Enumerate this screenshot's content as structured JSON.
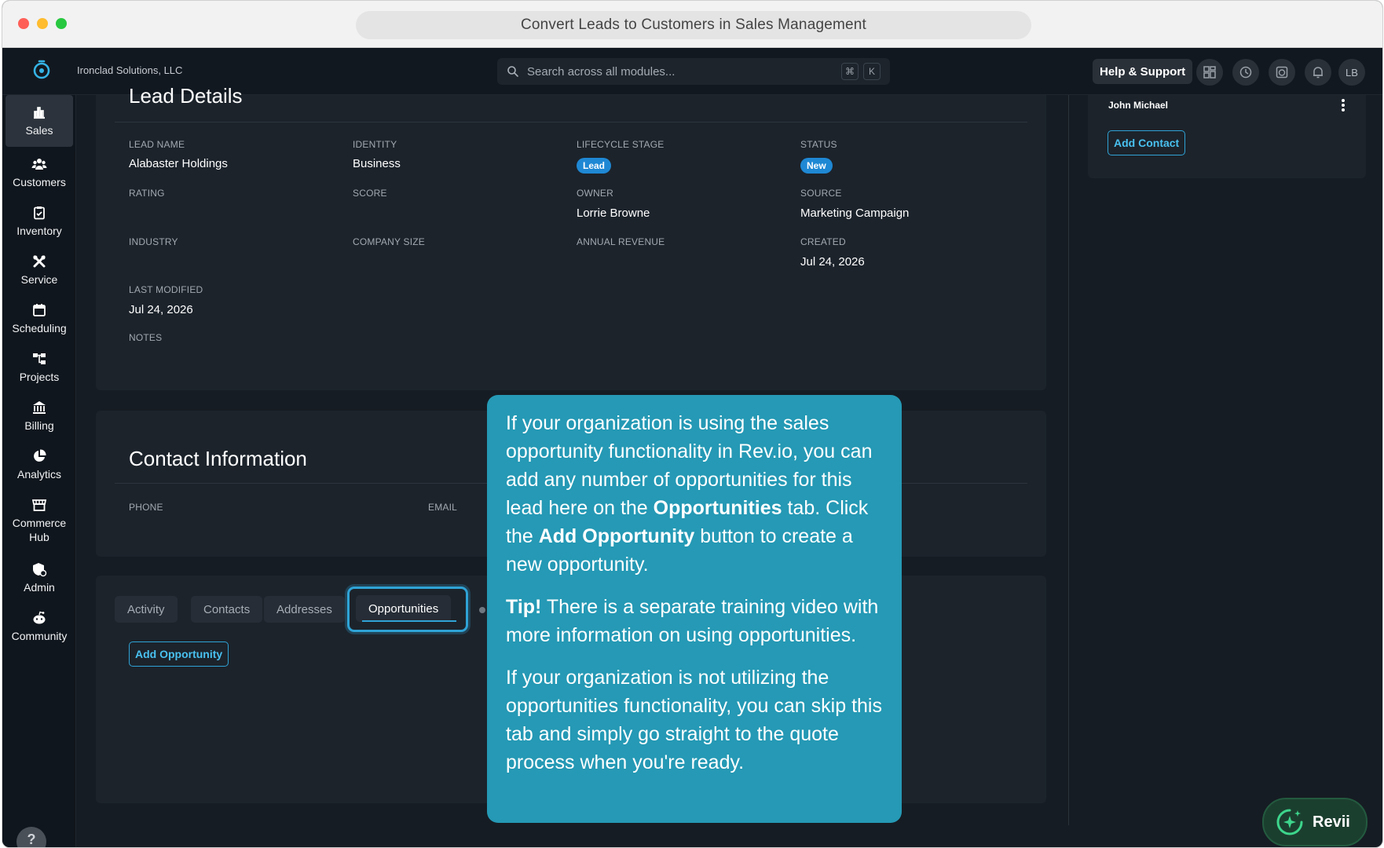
{
  "browser": {
    "url_title": "Convert Leads to Customers in Sales Management"
  },
  "topbar": {
    "org_name": "Ironclad Solutions, LLC",
    "search_placeholder": "Search across all modules...",
    "kbd_cmd": "⌘",
    "kbd_k": "K",
    "help_label": "Help & Support",
    "avatar_initials": "LB"
  },
  "sidebar": {
    "items": [
      {
        "label": "Sales",
        "icon": "chart-bar-icon"
      },
      {
        "label": "Customers",
        "icon": "users-icon"
      },
      {
        "label": "Inventory",
        "icon": "clipboard-icon"
      },
      {
        "label": "Service",
        "icon": "tools-icon"
      },
      {
        "label": "Scheduling",
        "icon": "calendar-icon"
      },
      {
        "label": "Projects",
        "icon": "hierarchy-icon"
      },
      {
        "label": "Billing",
        "icon": "bank-icon"
      },
      {
        "label": "Analytics",
        "icon": "pie-chart-icon"
      },
      {
        "label": "Commerce Hub",
        "icon": "storefront-icon"
      },
      {
        "label": "Admin",
        "icon": "shield-user-icon"
      },
      {
        "label": "Community",
        "icon": "community-icon"
      }
    ],
    "help_label": "?"
  },
  "lead": {
    "title": "Lead Details",
    "labels": {
      "lead_name": "Lead Name",
      "identity": "Identity",
      "lifecycle_stage": "Lifecycle Stage",
      "status": "Status",
      "rating": "Rating",
      "score": "Score",
      "owner": "Owner",
      "source": "Source",
      "industry": "Industry",
      "company_size": "Company Size",
      "annual_revenue": "Annual Revenue",
      "created": "Created",
      "last_modified": "Last Modified",
      "notes": "Notes"
    },
    "values": {
      "lead_name": "Alabaster Holdings",
      "identity": "Business",
      "lifecycle_stage": "Lead",
      "status": "New",
      "owner": "Lorrie Browne",
      "source": "Marketing Campaign",
      "created": "Jul 24, 2026",
      "last_modified": "Jul 24, 2026"
    }
  },
  "contact_info": {
    "title": "Contact Information",
    "phone_label": "Phone",
    "email_label": "Email"
  },
  "tabs": {
    "items": [
      "Activity",
      "Contacts",
      "Addresses",
      "Opportunities"
    ],
    "active": "Opportunities",
    "add_opportunity": "Add Opportunity"
  },
  "right_panel": {
    "contact_name": "John Michael",
    "add_contact": "Add Contact"
  },
  "tooltip": {
    "p1_a": "If your organization is using the sales opportunity functionality in Rev.io, you can add any number of opportunities for this lead here on the ",
    "p1_b": "Opportunities",
    "p1_c": " tab. Click the ",
    "p1_d": "Add Opportunity",
    "p1_e": " button to create a new opportunity.",
    "p2_a": "Tip!",
    "p2_b": " There is a separate training video with more information on using opportunities.",
    "p3": "If your organization is not utilizing the opportunities functionality, you can skip this tab and simply go straight to the quote process when you're ready."
  },
  "assistant": {
    "label": "Revii"
  },
  "colors": {
    "accent": "#2fa3d6",
    "tooltip_bg": "#2599b5",
    "pill": "#1f88d4",
    "bg": "#161c23"
  }
}
